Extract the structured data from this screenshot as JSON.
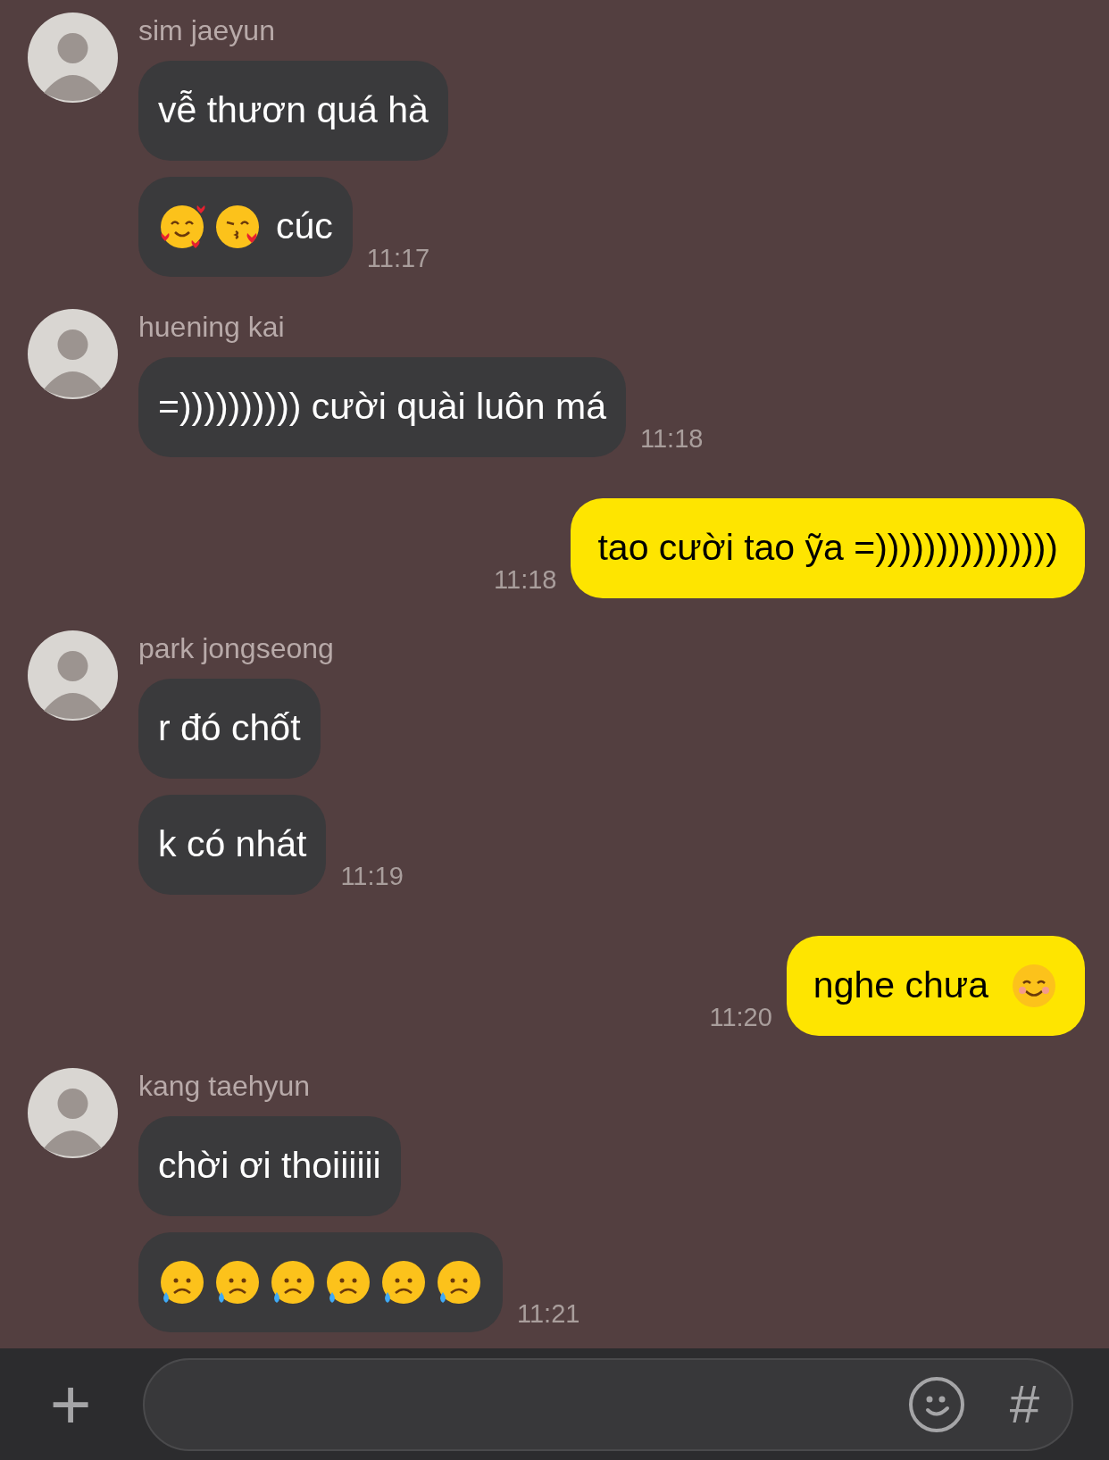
{
  "messages": [
    {
      "kind": "incoming",
      "sender": "sim jaeyun",
      "bubbles": [
        {
          "text": "vễ thươn quá hà"
        },
        {
          "text": "cúc",
          "emojis": [
            {
              "kind": "smiling-hearts"
            },
            {
              "kind": "kissing-heart"
            }
          ]
        }
      ],
      "time": "11:17"
    },
    {
      "kind": "incoming",
      "sender": "huening kai",
      "bubbles": [
        {
          "text": "=)))))))))) cười quài luôn má"
        }
      ],
      "time": "11:18"
    },
    {
      "kind": "outgoing",
      "bubbles": [
        {
          "text": "tao cười tao ỹa =)))))))))))))))"
        }
      ],
      "time": "11:18"
    },
    {
      "kind": "incoming",
      "sender": "park jongseong",
      "bubbles": [
        {
          "text": "r đó chốt"
        },
        {
          "text": "k có nhát"
        }
      ],
      "time": "11:19"
    },
    {
      "kind": "outgoing",
      "bubbles": [
        {
          "text": "nghe chưa",
          "emojis_after": [
            {
              "kind": "smiling-face"
            }
          ]
        }
      ],
      "time": "11:20"
    },
    {
      "kind": "incoming",
      "sender": "kang taehyun",
      "bubbles": [
        {
          "text": "chời ơi thoiiiiii"
        },
        {
          "emojis": [
            {
              "kind": "sad-sweat"
            },
            {
              "kind": "sad-sweat"
            },
            {
              "kind": "sad-sweat"
            },
            {
              "kind": "sad-sweat"
            },
            {
              "kind": "sad-sweat"
            },
            {
              "kind": "sad-sweat"
            }
          ]
        }
      ],
      "time": "11:21"
    }
  ],
  "composer": {
    "attach": "+",
    "hashtag": "#"
  }
}
